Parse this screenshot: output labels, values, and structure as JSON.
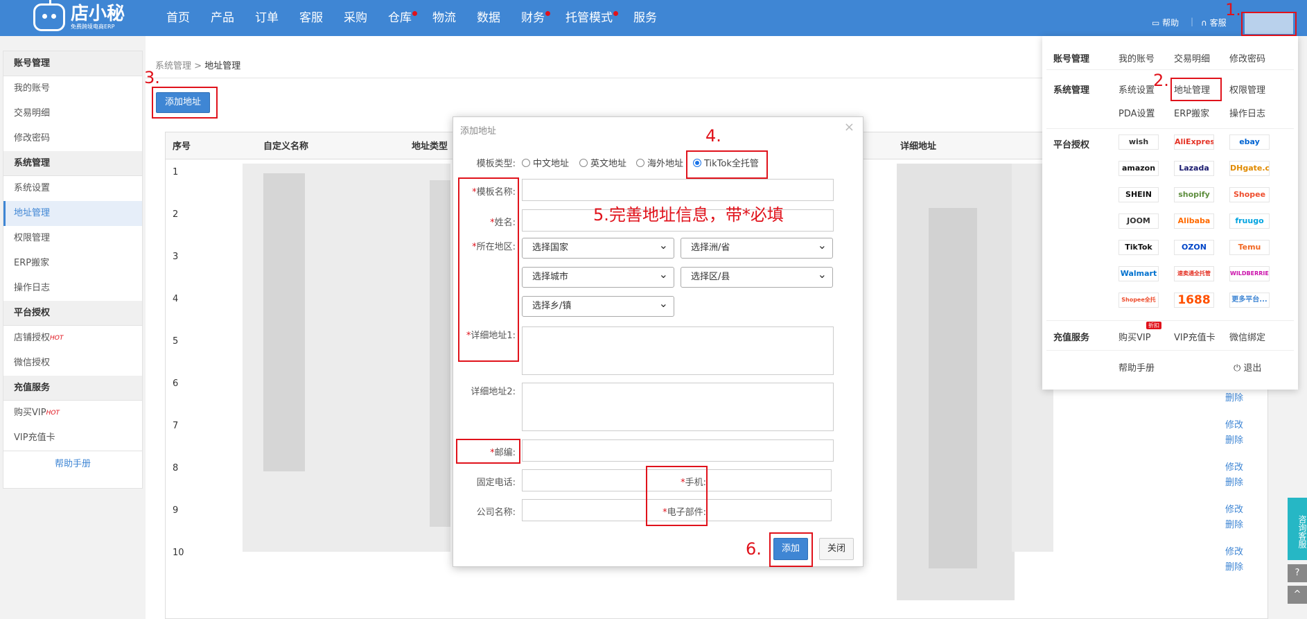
{
  "topbar": {
    "brand": "店小秘",
    "slogan": "免费跨境电商ERP",
    "nav": [
      "首页",
      "产品",
      "订单",
      "客服",
      "采购",
      "仓库",
      "物流",
      "数据",
      "财务",
      "托管模式",
      "服务"
    ],
    "help": "帮助",
    "service": "客服"
  },
  "sidebar": {
    "groups": [
      {
        "title": "账号管理",
        "items": [
          "我的账号",
          "交易明细",
          "修改密码"
        ]
      },
      {
        "title": "系统管理",
        "items": [
          "系统设置",
          "地址管理",
          "权限管理",
          "ERP搬家",
          "操作日志"
        ]
      },
      {
        "title": "平台授权",
        "items": [
          "店铺授权",
          "微信授权"
        ]
      },
      {
        "title": "充值服务",
        "items": [
          "购买VIP",
          "VIP充值卡"
        ]
      }
    ],
    "hot": "HOT",
    "help": "帮助手册"
  },
  "breadcrumb": {
    "parent": "系统管理",
    "sep": ">",
    "current": "地址管理"
  },
  "add_button": "添加地址",
  "table": {
    "headers": [
      "序号",
      "自定义名称",
      "地址类型",
      "详细地址"
    ],
    "rows": [
      "1",
      "2",
      "3",
      "4",
      "5",
      "6",
      "7",
      "8",
      "9",
      "10"
    ],
    "edit": "修改",
    "delete": "删除"
  },
  "dialog": {
    "title": "添加地址",
    "close": "×",
    "template_label": "模板类型:",
    "template_options": [
      "中文地址",
      "英文地址",
      "海外地址",
      "TikTok全托管"
    ],
    "labels": {
      "name": "模板名称:",
      "person": "姓名:",
      "region": "所在地区:",
      "addr1": "详细地址1:",
      "addr2": "详细地址2:",
      "zip": "邮编:",
      "tel": "固定电话:",
      "mobile": "手机:",
      "company": "公司名称:",
      "email": "电子部件:"
    },
    "req": "*",
    "selects": [
      "选择国家",
      "选择洲/省",
      "选择城市",
      "选择区/县",
      "选择乡/镇"
    ],
    "add": "添加",
    "close_btn": "关闭"
  },
  "menu": {
    "groups": [
      "账号管理",
      "系统管理",
      "平台授权",
      "充值服务"
    ],
    "account": [
      "我的账号",
      "交易明细",
      "修改密码"
    ],
    "system": [
      "系统设置",
      "地址管理",
      "权限管理",
      "PDA设置",
      "ERP搬家",
      "操作日志"
    ],
    "platforms": [
      "wish",
      "AliExpress",
      "ebay",
      "amazon",
      "Lazada",
      "DHgate.com",
      "SHEIN",
      "shopify",
      "Shopee",
      "JOOM",
      "Alibaba",
      "fruugo",
      "TikTok",
      "OZON",
      "Temu",
      "Walmart",
      "速卖通全托管",
      "WILDBERRIES",
      "Shopee全托管",
      "1688",
      "更多平台..."
    ],
    "recharge": [
      "购买VIP",
      "VIP充值卡",
      "微信绑定"
    ],
    "recharge_tag": "折扣",
    "help": "帮助手册",
    "logout": "退出"
  },
  "annotations": [
    "1.",
    "2.",
    "3.",
    "4.",
    "5.完善地址信息，带*必填",
    "6."
  ],
  "float": {
    "consult": "咨询客服",
    "help": "?",
    "top": "^"
  }
}
